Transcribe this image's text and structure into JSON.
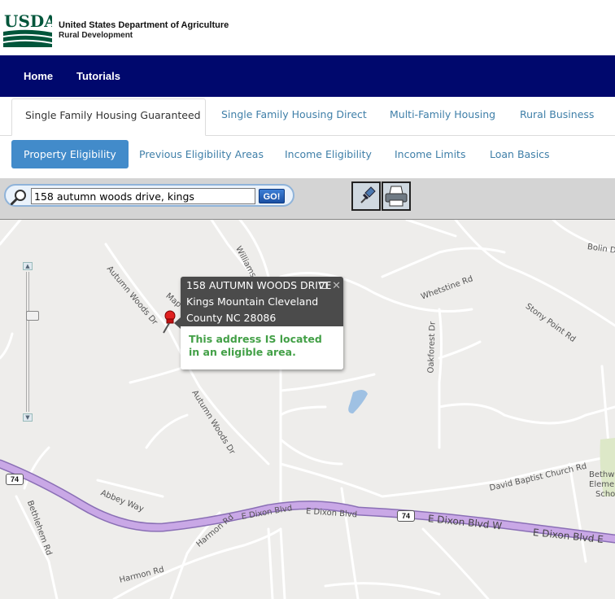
{
  "header": {
    "logo_text": "USDA",
    "agency_name": "United States Department of Agriculture",
    "agency_sub": "Rural Development"
  },
  "topnav": {
    "items": [
      "Home",
      "Tutorials"
    ]
  },
  "program_tabs": [
    {
      "label": "Single Family Housing Guaranteed",
      "active": true
    },
    {
      "label": "Single Family Housing Direct",
      "active": false
    },
    {
      "label": "Multi-Family Housing",
      "active": false
    },
    {
      "label": "Rural Business",
      "active": false
    }
  ],
  "subnav": [
    {
      "label": "Property Eligibility",
      "active": true
    },
    {
      "label": "Previous Eligibility Areas",
      "active": false
    },
    {
      "label": "Income Eligibility",
      "active": false
    },
    {
      "label": "Income Limits",
      "active": false
    },
    {
      "label": "Loan Basics",
      "active": false
    }
  ],
  "search": {
    "value": "158 autumn woods drive, kings",
    "go_label": "GO!"
  },
  "tools": [
    "pushpin-icon",
    "printer-icon"
  ],
  "colors": {
    "nav_bg": "#00086d",
    "active_pill": "#428bca",
    "link": "#3f7fa8",
    "eligible_green": "#43a047",
    "highway": "#c9a8e6"
  },
  "popup": {
    "address_line1": "158 AUTUMN WOODS DRIVE",
    "address_line2": "Kings Mountain Cleveland",
    "address_line3": "County NC 28086",
    "message": "This address IS located in an eligible area."
  },
  "map": {
    "roads": [
      "Autumn Woods Dr",
      "Map",
      "Williams",
      "Autumn Woods Dr",
      "Whetstine Rd",
      "Bolin D",
      "Stony Point Rd",
      "Oakforest Dr",
      "David Baptist Church Rd",
      "Bethw",
      "Eleme",
      "Scho",
      "E Dixon Blvd",
      "E Dixon Blvd",
      "E Dixon Blvd W",
      "E Dixon Blvd E",
      "Abbey Way",
      "Bethlehem Rd",
      "Harmon Rd",
      "Harmon Rd"
    ],
    "highway_shields": [
      "74",
      "74"
    ]
  }
}
